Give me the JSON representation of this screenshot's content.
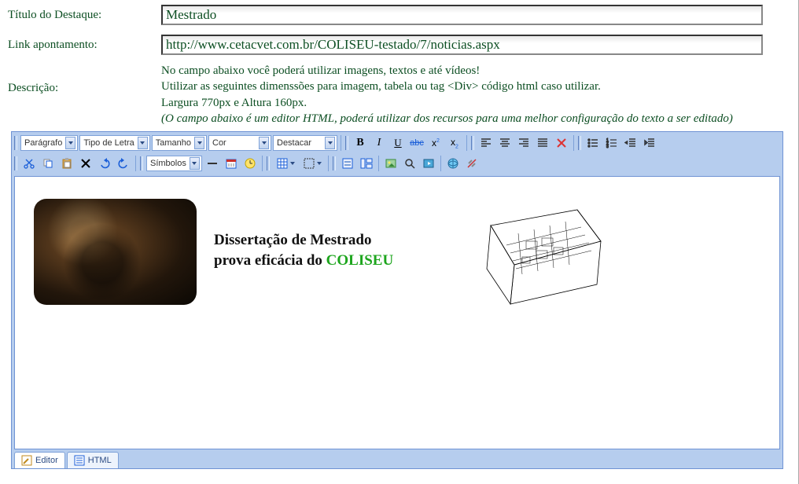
{
  "form": {
    "title_label": "Título do Destaque:",
    "title_value": "Mestrado",
    "link_label": "Link apontamento:",
    "link_value": "http://www.cetacvet.com.br/COLISEU-testado/7/noticias.aspx",
    "descr_label": "Descrição:",
    "descr_line1": "No campo abaixo você poderá utilizar imagens, textos e até vídeos!",
    "descr_line2": "Utilizar as seguintes dimenssões para imagem, tabela ou tag <Div> código html caso utilizar.",
    "descr_line3": "Largura 770px e Altura 160px.",
    "descr_line4": "(O campo abaixo é um editor HTML, poderá utilizar dos recursos para uma melhor configuração do texto a ser editado)"
  },
  "toolbar": {
    "paragraph": "Parágrafo",
    "font": "Tipo de Letra",
    "size": "Tamanho",
    "color": "Cor",
    "highlight": "Destacar",
    "symbols": "Símbolos"
  },
  "content": {
    "line1": "Dissertação de Mestrado",
    "line2a": "prova eficácia do ",
    "line2b": "COLISEU"
  },
  "tabs": {
    "editor": "Editor",
    "html": "HTML"
  }
}
